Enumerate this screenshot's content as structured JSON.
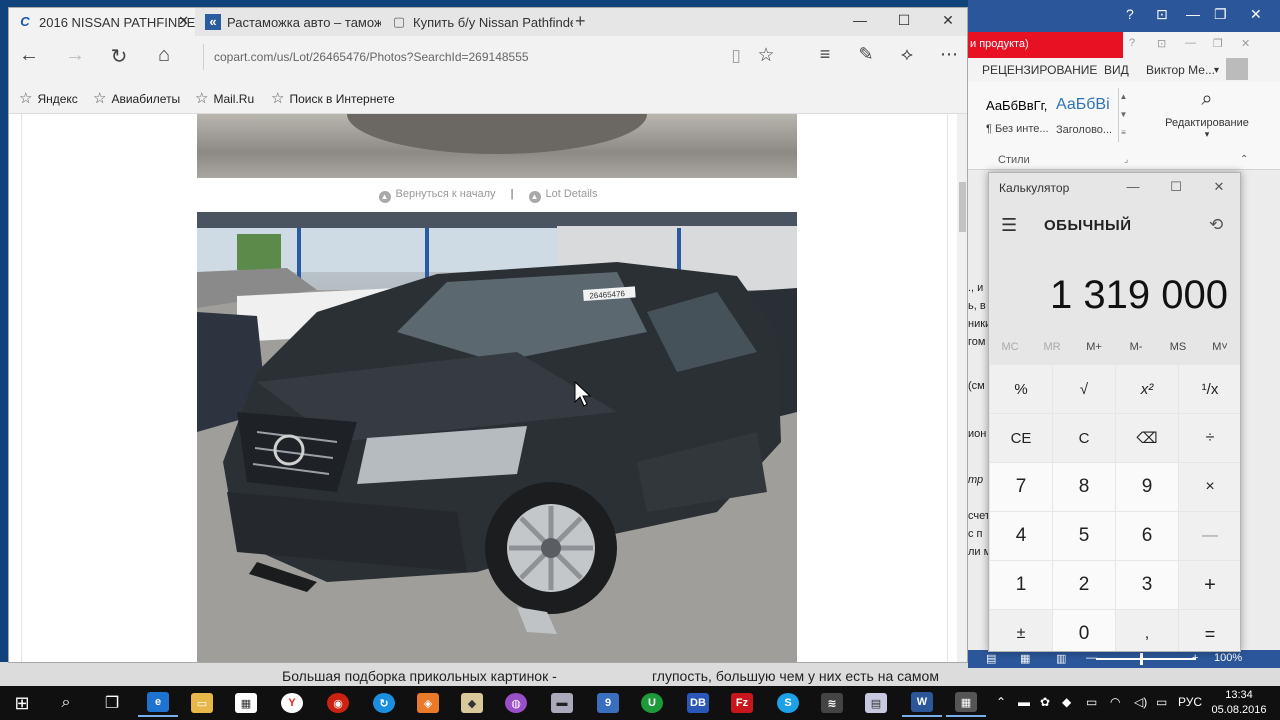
{
  "browser": {
    "tabs": [
      {
        "title": "2016 NISSAN PATHFINDE",
        "icon": "copart-c-icon",
        "glyph": "C",
        "active": true
      },
      {
        "title": "Растаможка авто – таможе",
        "icon": "customs-logo-icon",
        "glyph": "«",
        "active": false
      },
      {
        "title": "Купить б/у Nissan Pathfinde",
        "icon": "page-icon",
        "glyph": "▢",
        "active": false
      }
    ],
    "address": "copart.com/us/Lot/26465476/Photos?SearchId=269148555",
    "favorites": [
      "Яндекс",
      "Авиабилеты",
      "Mail.Ru",
      "Поиск в Интернете"
    ],
    "photo_links": {
      "back_to_top": "Вернуться к началу",
      "separator": "|",
      "lot_details": "Lot Details"
    },
    "lot_sticker": "26465476"
  },
  "word": {
    "doc_title": "и продукта)",
    "tabs": [
      "РЕЦЕНЗИРОВАНИЕ",
      "ВИД",
      "Виктор Ме..."
    ],
    "styles": [
      {
        "big": "АаБбВвГг,",
        "small": "¶ Без инте..."
      },
      {
        "big": "АаБбВі",
        "small": "Заголово..."
      }
    ],
    "editing_label": "Редактирование",
    "styles_label": "Стили",
    "doc_fragments": [
      "., и",
      "ь, в",
      "ники",
      "гом",
      "(см",
      "ион",
      "тр",
      "счет",
      "с п",
      "ли м"
    ],
    "zoom": "100%"
  },
  "calculator": {
    "title": "Калькулятор",
    "mode": "ОБЫЧНЫЙ",
    "display": "1 319 000",
    "memory": [
      "MC",
      "MR",
      "M+",
      "M-",
      "MS",
      "M˅"
    ],
    "keys": [
      [
        "%",
        "√",
        "x²",
        "¹/x"
      ],
      [
        "CE",
        "C",
        "⌫",
        "÷"
      ],
      [
        "7",
        "8",
        "9",
        "×"
      ],
      [
        "4",
        "5",
        "6",
        "—"
      ],
      [
        "1",
        "2",
        "3",
        "+"
      ],
      [
        "±",
        "0",
        ",",
        "="
      ]
    ]
  },
  "background_texts": [
    "Большая подборка прикольных картинок -",
    "глупость, большую чем у них есть на самом"
  ],
  "taskbar": {
    "language": "РУС",
    "time": "13:34",
    "date": "05.08.2016"
  },
  "colors": {
    "word_blue": "#2b579a",
    "alert_red": "#e81123",
    "taskbar": "#101010",
    "desktop": "#10437a"
  }
}
